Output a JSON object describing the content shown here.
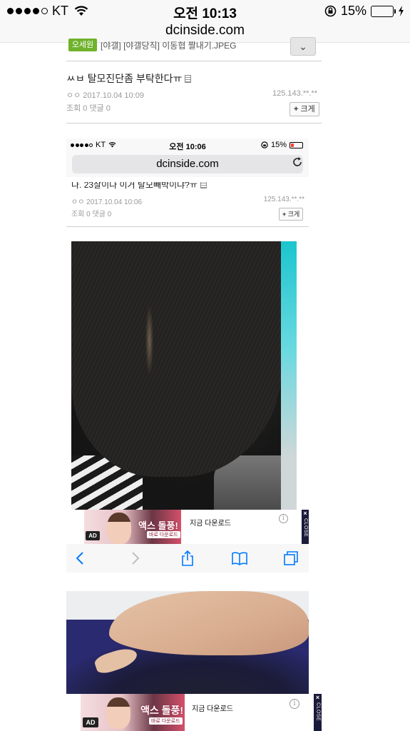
{
  "status_bar": {
    "carrier": "KT",
    "time": "오전 10:13",
    "battery_percent": "15%",
    "battery_level": 0.15,
    "signal_bars_filled": 4
  },
  "url_bar": {
    "domain": "dcinside.com"
  },
  "outer_post_header": {
    "badge": "오세원",
    "cropped_title": "[야갤] [야갤당직] 이동협 짤내기.JPEG"
  },
  "outer_post": {
    "title": "ㅆㅂ 탈모진단좀 부탁한다ㅠ",
    "author_date": "ㅇㅇ 2017.10.04 10:09",
    "ip": "125.143.**.**",
    "stats": "조회 0 댓글 0",
    "enlarge_label": "크게"
  },
  "inner_screenshot": {
    "status_bar": {
      "carrier": "KT",
      "time": "오전 10:06",
      "battery_percent": "15%"
    },
    "url": "dcinside.com",
    "post_title": "나. 23살이다 이거 탈모빼박이냐?ㅠ",
    "author_date": "ㅇㅇ 2017.10.04 10:06",
    "ip": "125.143.**.**",
    "stats": "조회 0 댓글 0",
    "enlarge_label": "크게"
  },
  "ads": [
    {
      "label": "AD",
      "headline": "액스 돌풍!",
      "sub": "바로 다운로드",
      "text": "지금 다운로드",
      "info": "i",
      "close": "CLOSE"
    },
    {
      "label": "AD",
      "headline": "액스 돌풍!",
      "sub": "바로 다운로드",
      "text": "지금 다운로드",
      "info": "i",
      "close": "CLOSE"
    }
  ],
  "icons": {
    "toolbar": [
      "back-arrow-icon",
      "forward-arrow-icon",
      "share-icon",
      "bookmarks-icon",
      "tabs-icon"
    ],
    "accent": "#007aff"
  }
}
